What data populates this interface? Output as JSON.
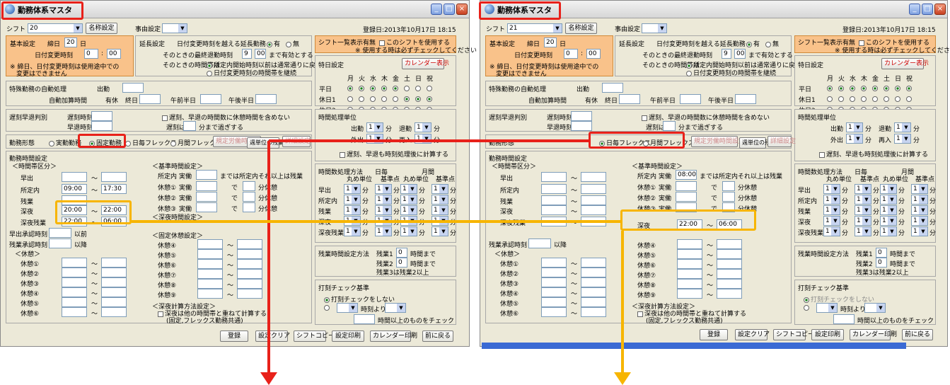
{
  "left": {
    "title": "勤務体系マスタ",
    "shift_label": "シフト",
    "shift_value": "20",
    "meisho_btn": "名称設定",
    "jiyu_label": "事由設定",
    "registered": "登録日:2013年10月17日 18:15",
    "basic_label": "基本設定",
    "shime_label": "締日",
    "shime_value": "20",
    "day": "日",
    "henko_label": "日付変更時刻",
    "henko_h": "0",
    "henko_m": "00",
    "basic_note1": "※ 締日、日付変更時刻は使用途中での",
    "basic_note2": "変更はできません",
    "encho_label": "延長設定",
    "encho_q": "日付変更時刻を越える延長勤務",
    "yes": "有",
    "no": "無",
    "saishu": "そのときの最終退勤時刻",
    "saishu_h": "9",
    "saishu_m": "00",
    "yuko": "まで有効とする",
    "jikantai": "そのときの時間帯は",
    "opt1": "所定内開始時刻以前は通常通りに戻る",
    "opt2": "日付変更時刻の時間帯を継続",
    "ichiran": "シフト一覧表示有無",
    "use_shift": "このシフトを使用する",
    "use_note": "※ 使用する時は必ずチェックしてください",
    "tokubi": "特日設定",
    "cal_btn": "カレンダー表示",
    "days": [
      "月",
      "火",
      "水",
      "木",
      "金",
      "土",
      "日",
      "祝"
    ],
    "heijitsu": "平日",
    "kyujitsu1": "休日1",
    "kyujitsu2": "休日2",
    "tokushu": "特殊勤務の自動処理",
    "jidou": "自動加算時間",
    "shukkin": "出勤",
    "yukyu": "有休",
    "shuujitsu": "終日",
    "gozen": "午前半日",
    "gogo": "午後半日",
    "chikoku": "遅刻早退判別",
    "chikoku_t": "遅刻時刻",
    "soutai_t": "早退時刻",
    "chikoku_chk": "遅刻、早退の時間数に休憩時間を含めない",
    "chikoku_wa": "遅刻は",
    "bun": "分まで通常",
    "jiko": "分まで過ぎする",
    "jikan_tani": "時間処理単位",
    "shukkin_u": "出勤",
    "taikin_u": "退勤",
    "gaishutsu": "外出",
    "sainyu": "再入",
    "one": "1",
    "min": "分",
    "round_chk": "遅刻、早退も時刻処理後に計算する",
    "keitai": "勤務形態",
    "keitai1": "実勤勤務",
    "keitai2": "固定勤務",
    "keitai3": "日毎フレックス",
    "keitai4": "月間フレックス",
    "kisoku_btn": "規定労働時間設定",
    "shuuchou_btn": "週単位の残業設定",
    "shousai_btn": "詳細設定",
    "jikan_settei": "勤務時間設定",
    "jikantai_kubun": "＜時間帯区分＞",
    "hayade": "早出",
    "shoteinai": "所定内",
    "zangyou": "残業",
    "shinya": "深夜",
    "shinya_zan": "深夜残業",
    "shoteinai_from": "09:00",
    "shoteinai_to": "17:30",
    "shinya_from": "20:00",
    "shinya_to": "22:00",
    "shinyazan_from": "22:00",
    "shinyazan_to": "06:00",
    "tilde": "～",
    "hayade_nin": "早出承認時刻",
    "zan_nin": "残業承認時刻",
    "izen": "以前",
    "igo": "以降",
    "kyukei": "＜休憩＞",
    "kyukei_items": [
      "休憩①",
      "休憩②",
      "休憩③",
      "休憩④",
      "休憩⑤",
      "休憩⑥"
    ],
    "kijun": "＜基準時間設定＞",
    "kijun_shotei": "所定内",
    "jitsudou": "実働",
    "kijun_made": "までは所定内それ以上は残業",
    "de": "で",
    "kyukei_fun": "分休憩",
    "kijun_kyu": [
      "休憩①",
      "休憩②",
      "休憩③"
    ],
    "shinya_kyu": "＜深夜時間設定＞",
    "kotei_kyu": "＜固定休憩設定＞",
    "kotei_items": [
      "休憩④",
      "休憩⑤",
      "休憩⑥",
      "休憩⑦",
      "休憩⑧",
      "休憩⑨"
    ],
    "shinya_calc": "＜深夜計算方法設定＞",
    "shinya_calc_chk": "深夜は他の時間帯と重ねて計算する",
    "shinya_calc_note": "(固定,フレックス勤務共通)",
    "gaikatsu": "時間数処理方法",
    "hibetsu": "日毎",
    "getsu": "月間",
    "maru_tani": "丸め単位",
    "kijunten": "基準点",
    "round_rows": [
      "早出",
      "所定内",
      "残業",
      "深夜",
      "深夜残業"
    ],
    "zan_set": "残業時間設定方法",
    "zan1": "残業1",
    "zan1_v": "0",
    "zan_made": "時間まで",
    "zan2": "残業2",
    "zan2_v": "0",
    "zan3": "残業3は残業2以上",
    "dakoku": "打刻チェック基準",
    "dakoku_opt1": "打刻チェックをしない",
    "jikoku_yori": "時刻より",
    "jikan_ijou": "時間以上のものをチェック",
    "buttons": [
      "登録",
      "設定クリア",
      "シフトコピー",
      "設定印刷",
      "カレンダー印刷",
      "前に戻る"
    ]
  },
  "right": {
    "title": "勤務体系マスタ",
    "shift_value": "21",
    "registered": "登録日:2013年10月17日 18:15",
    "keitai3": "日毎フレックス",
    "keitai4": "月間フレックス",
    "kijun_from": "08:00",
    "shinya_from": "22:00",
    "shinya_to": "06:00",
    "taskbar_items": [
      "",
      "",
      "",
      ""
    ]
  },
  "colors": {
    "red": "#e8211a",
    "orange": "#f7b500",
    "panel": "#ece9d8",
    "peach": "#f9c28a"
  }
}
